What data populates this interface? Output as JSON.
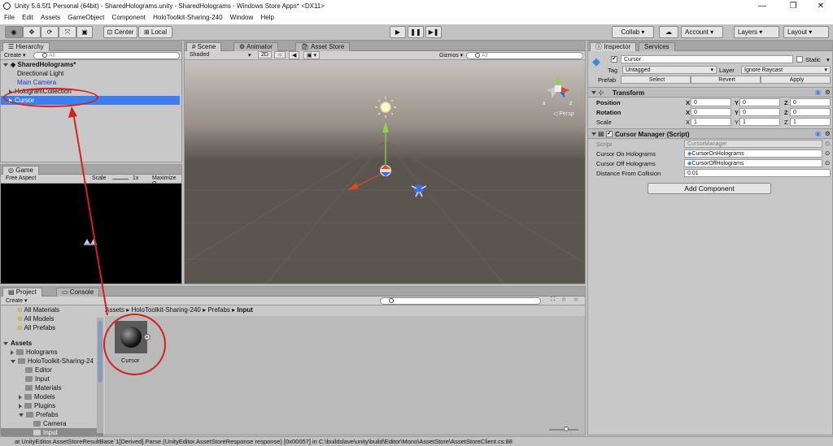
{
  "window": {
    "title": "Unity 5.6.5f1 Personal (64bit) - SharedHolograms.unity - SharedHolograms - Windows Store Apps* <DX11>"
  },
  "menu": [
    "File",
    "Edit",
    "Assets",
    "GameObject",
    "Component",
    "HoloToolkit-Sharing-240",
    "Window",
    "Help"
  ],
  "toolbar": {
    "center": "Center",
    "local": "Local",
    "collab": "Collab ▾",
    "account": "Account",
    "layers": "Layers",
    "layout": "Layout"
  },
  "hierarchy": {
    "tab": "Hierarchy",
    "create": "Create",
    "search_placeholder": "All",
    "scene": "SharedHolograms*",
    "items": [
      "Directional Light",
      "Main Camera",
      "HologramCollection",
      "Cursor"
    ]
  },
  "game": {
    "tab": "Game",
    "aspect": "Free Aspect",
    "scale_label": "Scale",
    "scale_value": "1x",
    "maximize": "Maximize O"
  },
  "scene": {
    "tabs": [
      "Scene",
      "Animator",
      "Asset Store"
    ],
    "shading": "Shaded",
    "mode2d": "2D",
    "gizmos": "Gizmos",
    "search_placeholder": "All",
    "persp": "Persp",
    "axis_x": "x",
    "axis_z": "z"
  },
  "inspector": {
    "tabs": [
      "Inspector",
      "Services"
    ],
    "name": "Cursor",
    "static_label": "Static",
    "tag_label": "Tag",
    "tag_value": "Untagged",
    "layer_label": "Layer",
    "layer_value": "Ignore Raycast",
    "prefab_label": "Prefab",
    "prefab_select": "Select",
    "prefab_revert": "Revert",
    "prefab_apply": "Apply",
    "transform": {
      "title": "Transform",
      "position_label": "Position",
      "rotation_label": "Rotation",
      "scale_label": "Scale",
      "x": "X",
      "y": "Y",
      "z": "Z",
      "position": [
        "0",
        "0",
        "0"
      ],
      "rotation": [
        "0",
        "0",
        "0"
      ],
      "scale": [
        "1",
        "1",
        "1"
      ]
    },
    "cursor_manager": {
      "title": "Cursor Manager (Script)",
      "script_label": "Script",
      "script_value": "CursorManager",
      "on_label": "Cursor On Holograms",
      "on_value": "CursorOnHolograms",
      "off_label": "Cursor Off Holograms",
      "off_value": "CursorOffHolograms",
      "dist_label": "Distance From Collision",
      "dist_value": "0.01"
    },
    "add_component": "Add Component"
  },
  "project": {
    "tabs": [
      "Project",
      "Console"
    ],
    "create": "Create",
    "favorites": [
      "All Materials",
      "All Models",
      "All Prefabs"
    ],
    "assets_root": "Assets",
    "tree": [
      "Holograms",
      "HoloToolkit-Sharing-24",
      "Editor",
      "Input",
      "Materials",
      "Models",
      "Plugins",
      "Prefabs",
      "Camera",
      "Input"
    ],
    "breadcrumb": [
      "Assets",
      "HoloToolkit-Sharing-240",
      "Prefabs",
      "Input"
    ],
    "asset_name": "Cursor"
  },
  "status": "at UnityEditor.AssetStoreResultBase`1[Derived].Parse (UnityEditor.AssetStoreResponse response) [0x00057] in C:\\buildslave\\unity\\build\\Editor\\Mono\\AssetStore\\AssetStoreClient.cs:88",
  "colors": {
    "annotation": "#d32020",
    "selection": "#3d7ff0",
    "scene_bg": "#5b5550",
    "sky": "#c7c2bd"
  }
}
